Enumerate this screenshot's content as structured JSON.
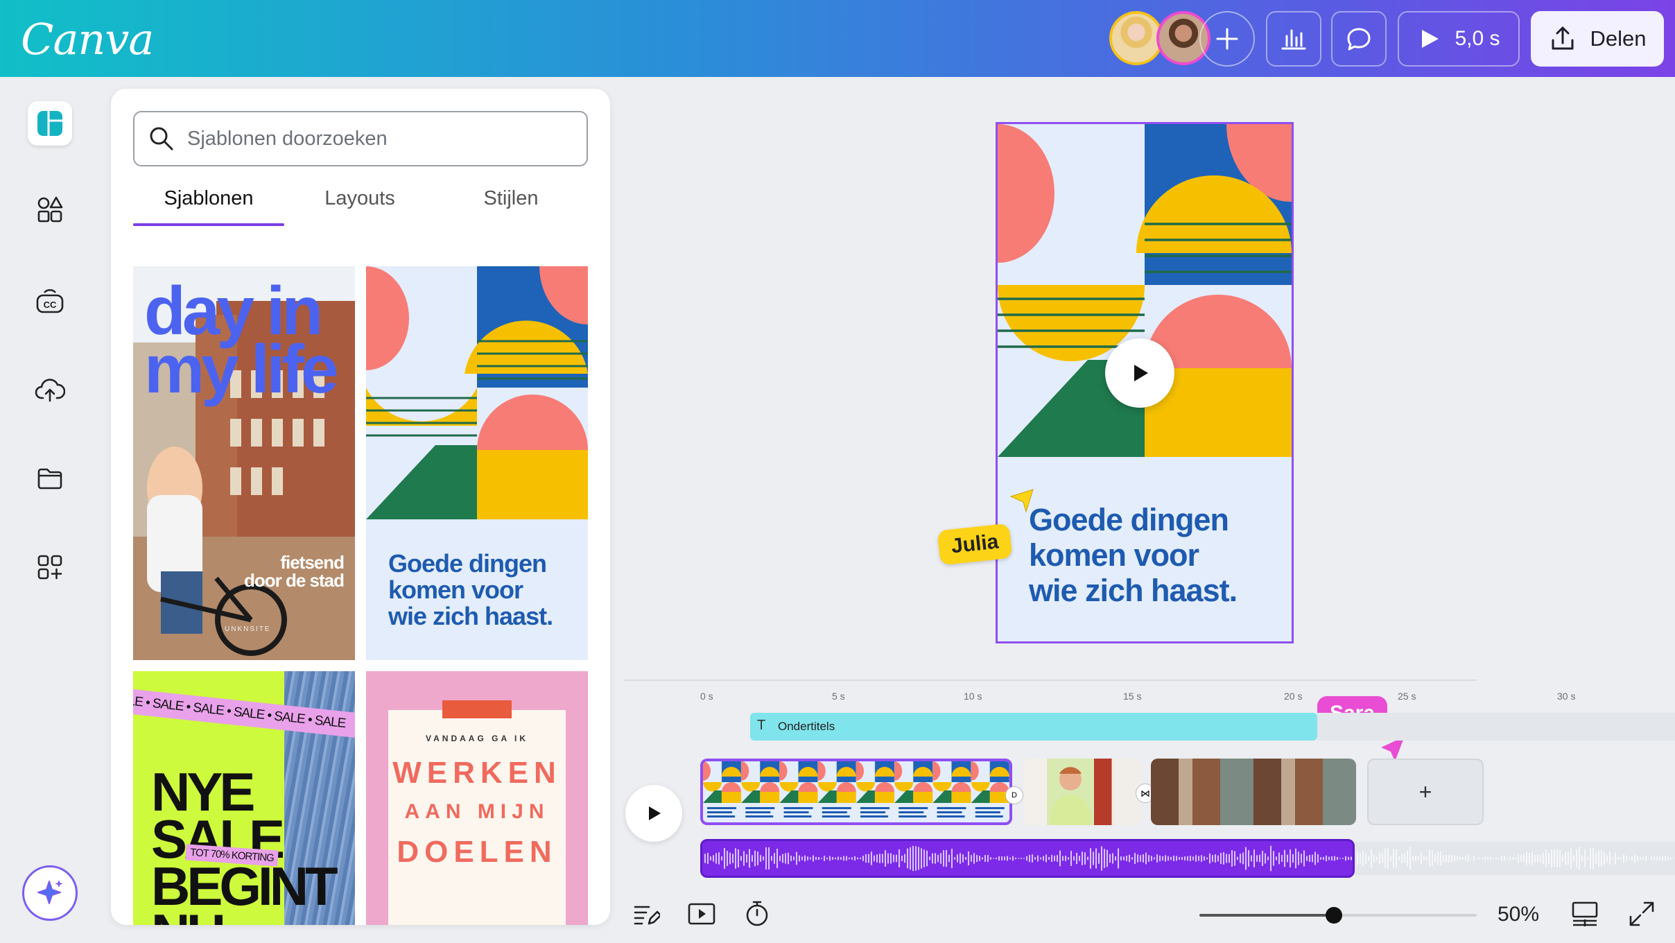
{
  "app": {
    "logo": "Canva"
  },
  "header": {
    "play_duration": "5,0 s",
    "share_label": "Delen",
    "icons": [
      "plus-icon",
      "chart-bars-icon",
      "comment-icon",
      "play-icon",
      "upload-icon"
    ]
  },
  "rail": {
    "items": [
      "templates-icon",
      "elements-icon",
      "text-icon",
      "uploads-icon",
      "projects-icon",
      "apps-icon",
      "magic-icon"
    ]
  },
  "panel": {
    "search_placeholder": "Sjablonen doorzoeken",
    "tabs": [
      {
        "label": "Sjablonen",
        "active": true
      },
      {
        "label": "Layouts",
        "active": false
      },
      {
        "label": "Stijlen",
        "active": false
      }
    ],
    "templates": {
      "t1": {
        "big": "day in\nmy life",
        "small": "fietsend\ndoor de stad",
        "credit": "UNKNSITE"
      },
      "t2": {
        "quote": "Goede dingen\nkomen voor\nwie zich haast."
      },
      "t3": {
        "ribbon": "ALE • SALE • SALE • SALE • SALE • SALE",
        "head": "NYE\nSALE\nBEGINT\nNU",
        "tag": "TOT 70% KORTING"
      },
      "t4": {
        "l1": "VANDAAG GA IK",
        "l2": "WERKEN",
        "l3": "AAN MIJN",
        "l4": "DOELEN"
      }
    }
  },
  "canvas": {
    "text": "Goede dingen\nkomen voor\nwie zich haast.",
    "collaborators": {
      "julia": "Julia",
      "sara": "Sara"
    }
  },
  "timeline": {
    "ticks": [
      "0 s",
      "5 s",
      "10 s",
      "15 s",
      "20 s",
      "25 s",
      "30 s"
    ],
    "subtitle_label": "Ondertitels",
    "clip_caption": "Goede dingen komen voor wie zich haast.",
    "add_label": "+"
  },
  "footer": {
    "zoom": "50%",
    "zoom_fraction": 0.5
  },
  "colors": {
    "accent": "#7b3fe4",
    "selection": "#8f4ff1",
    "design_blue": "#1e5bb0",
    "audio": "#7d2ae8",
    "subtitle": "#80e4ec"
  }
}
